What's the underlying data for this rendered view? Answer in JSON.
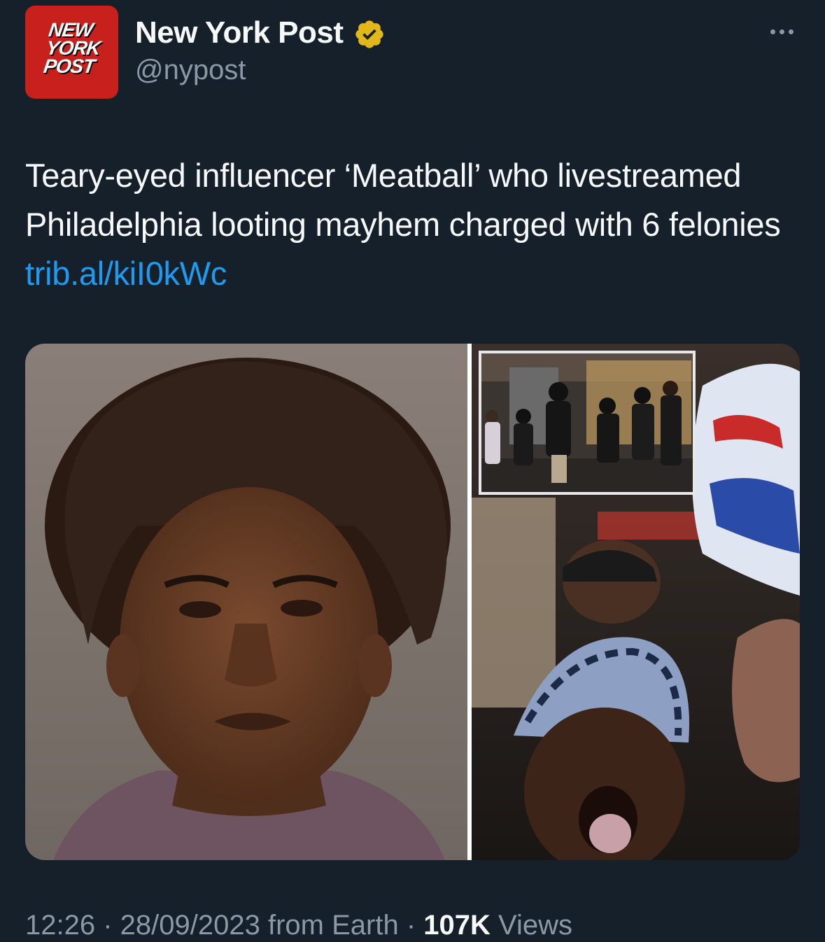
{
  "author": {
    "logo_lines": [
      "NEW",
      "YORK",
      "POST"
    ],
    "display_name": "New York Post",
    "handle": "@nypost",
    "verified": true,
    "badge_color": "#e2b719"
  },
  "tweet": {
    "text": "Teary-eyed influencer ‘Meatball’ who livestreamed Philadelphia looting mayhem charged with 6 felonies ",
    "link": "trib.al/kiI0kWc"
  },
  "media": {
    "icons": [
      "mugshot-photo",
      "looting-inset-photo",
      "livestream-selfie-photo"
    ]
  },
  "footer": {
    "time": "12:26",
    "separator": " · ",
    "date": "28/09/2023",
    "source": "from Earth",
    "views_count": "107K",
    "views_label": "Views"
  },
  "colors": {
    "background": "#15202b",
    "text": "#f7f9f9",
    "secondary": "#8b98a5",
    "link": "#1d9bf0",
    "brand": "#c8201c"
  }
}
